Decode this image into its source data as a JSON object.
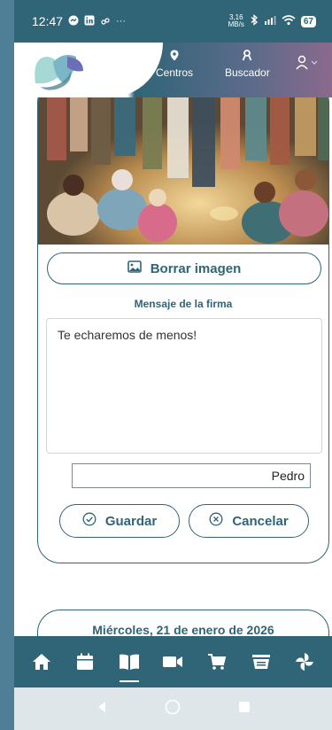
{
  "status_bar": {
    "time": "12:47",
    "more": "···",
    "speed": "3,16",
    "speed_unit": "MB/s",
    "battery": "67"
  },
  "header": {
    "nav_centros": "Centros",
    "nav_buscador": "Buscador"
  },
  "card": {
    "borrar_label": "Borrar imagen",
    "signature_label": "Mensaje de la firma",
    "message_value": "Te echaremos de menos!",
    "name_value": "Pedro",
    "guardar_label": "Guardar",
    "cancelar_label": "Cancelar"
  },
  "date_card": {
    "date_text": "Miércoles, 21 de enero de 2026"
  },
  "bottom_nav": {
    "items": [
      "home-icon",
      "calendar-icon",
      "book-icon",
      "video-icon",
      "cart-icon",
      "list-icon",
      "pinwheel-icon"
    ],
    "active": "book-icon"
  },
  "colors": {
    "primary": "#2f6577",
    "accent_purple": "#8a6a8d",
    "background": "#4f7f96"
  }
}
